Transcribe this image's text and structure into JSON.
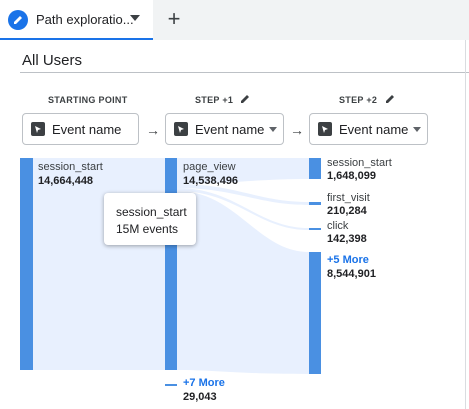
{
  "tab": {
    "label": "Path exploratio...",
    "add_label": "+"
  },
  "segment": "All Users",
  "columns": [
    {
      "header": "STARTING POINT",
      "dropdown": "Event name"
    },
    {
      "header": "STEP +1",
      "dropdown": "Event name"
    },
    {
      "header": "STEP +2",
      "dropdown": "Event name"
    }
  ],
  "start_node": {
    "name": "session_start",
    "count": "14,664,448"
  },
  "step1_nodes": [
    {
      "name": "page_view",
      "count": "14,538,496"
    },
    {
      "name": "+7 More",
      "count": "29,043"
    }
  ],
  "step2_nodes": [
    {
      "name": "session_start",
      "count": "1,648,099"
    },
    {
      "name": "first_visit",
      "count": "210,284"
    },
    {
      "name": "click",
      "count": "142,398"
    },
    {
      "name": "+5 More",
      "count": "8,544,901"
    }
  ],
  "tooltip": {
    "title": "session_start",
    "value": "15M events"
  },
  "colors": {
    "node": "#4a90e2",
    "flow": "#e8f0fe",
    "accent": "#1a73e8"
  }
}
